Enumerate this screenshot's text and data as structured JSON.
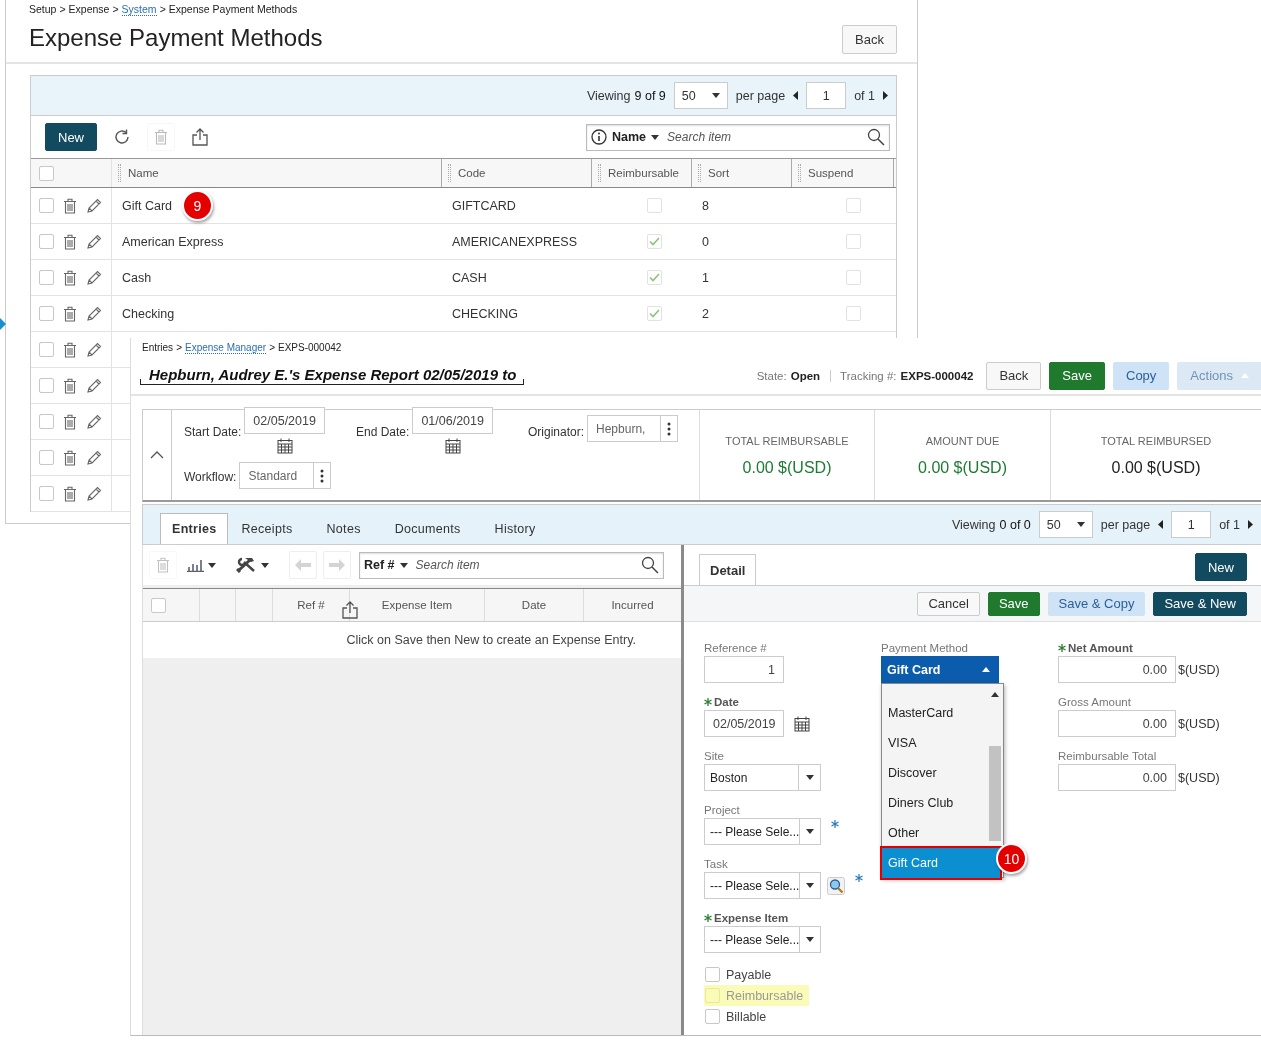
{
  "back_window": {
    "breadcrumb": {
      "separator": ">",
      "items": [
        {
          "text": "Setup",
          "link": false
        },
        {
          "text": "Expense",
          "link": false
        },
        {
          "text": "System",
          "link": true
        },
        {
          "text": "Expense Payment Methods",
          "link": false
        }
      ]
    },
    "title": "Expense Payment Methods",
    "back_button": "Back",
    "pager": {
      "viewing": "Viewing",
      "count": "9 of 9",
      "per_page": "50",
      "per_page_label": "per page",
      "page": "1",
      "of": "of 1"
    },
    "new_button": "New",
    "search": {
      "field": "Name",
      "placeholder": "Search item"
    },
    "select_all_checked": false,
    "columns": [
      "Name",
      "Code",
      "Reimbursable",
      "Sort",
      "Suspend"
    ],
    "rows": [
      {
        "kind": "full",
        "checked": false,
        "name": "Gift Card",
        "callout": "9",
        "code": "GIFTCARD",
        "reimbursable": false,
        "sort": "8",
        "suspend": false
      },
      {
        "kind": "full",
        "checked": false,
        "name": "American Express",
        "code": "AMERICANEXPRESS",
        "reimbursable": true,
        "sort": "0",
        "suspend": false
      },
      {
        "kind": "full",
        "checked": false,
        "name": "Cash",
        "code": "CASH",
        "reimbursable": true,
        "sort": "1",
        "suspend": false
      },
      {
        "kind": "full",
        "checked": false,
        "name": "Checking",
        "code": "CHECKING",
        "reimbursable": true,
        "sort": "2",
        "suspend": false
      },
      {
        "kind": "covered",
        "checked": false
      },
      {
        "kind": "covered",
        "checked": false
      },
      {
        "kind": "covered",
        "checked": false
      },
      {
        "kind": "covered",
        "checked": false
      },
      {
        "kind": "covered",
        "checked": false
      }
    ]
  },
  "front_window": {
    "breadcrumb": {
      "separator": ">",
      "items": [
        {
          "text": "Entries",
          "link": false
        },
        {
          "text": "Expense Manager",
          "link": true
        },
        {
          "text": "EXPS-000042",
          "link": false
        }
      ]
    },
    "title": "Hepburn, Audrey E.'s Expense Report 02/05/2019 to",
    "state_label": "State:",
    "state": "Open",
    "tracking_label": "Tracking #:",
    "tracking": "EXPS-000042",
    "buttons": [
      {
        "label": "Back",
        "kind": "default",
        "disabled": false
      },
      {
        "label": "Save",
        "kind": "primary",
        "disabled": false
      },
      {
        "label": "Copy",
        "kind": "light",
        "disabled": false
      },
      {
        "label": "Actions",
        "kind": "menu",
        "disabled": true
      }
    ],
    "header_fields": [
      {
        "label": "Start Date:",
        "value": "02/05/2019",
        "kind": "date"
      },
      {
        "label": "End Date:",
        "value": "01/06/2019",
        "kind": "date"
      },
      {
        "label": "Originator:",
        "value": "Hepburn,",
        "kind": "picker"
      },
      {
        "label": "Workflow:",
        "value": "Standard",
        "kind": "picker"
      }
    ],
    "totals": [
      {
        "label": "TOTAL REIMBURSABLE",
        "value": "0.00 $(USD)",
        "color": "#1e7b34"
      },
      {
        "label": "AMOUNT DUE",
        "value": "0.00 $(USD)",
        "color": "#1e7b34"
      },
      {
        "label": "TOTAL REIMBURSED",
        "value": "0.00 $(USD)",
        "color": "#222222"
      }
    ],
    "tabs": [
      {
        "label": "Entries",
        "selected": true
      },
      {
        "label": "Receipts",
        "selected": false
      },
      {
        "label": "Notes",
        "selected": false
      },
      {
        "label": "Documents",
        "selected": false
      },
      {
        "label": "History",
        "selected": false
      }
    ],
    "pager": {
      "viewing": "Viewing",
      "count": "0 of 0",
      "per_page": "50",
      "per_page_label": "per page",
      "page": "1",
      "of": "of 1"
    },
    "search": {
      "field": "Ref #",
      "placeholder": "Search item"
    },
    "select_all_checked": false,
    "columns": [
      "Ref #",
      "Expense Item",
      "Date",
      "Incurred"
    ],
    "empty_message": "Click on Save then New to create an Expense Entry.",
    "detail": {
      "tab": "Detail",
      "new_button": "New",
      "actions": [
        {
          "label": "Cancel",
          "kind": "default"
        },
        {
          "label": "Save",
          "kind": "primary"
        },
        {
          "label": "Save & Copy",
          "kind": "light"
        },
        {
          "label": "Save & New",
          "kind": "dark"
        }
      ],
      "left_fields": [
        {
          "label": "Reference #",
          "kind": "number",
          "value": "1",
          "required": false
        },
        {
          "label": "Date",
          "kind": "date",
          "value": "02/05/2019",
          "required": true
        },
        {
          "label": "Site",
          "kind": "select",
          "value": "Boston",
          "required": false
        },
        {
          "label": "Project",
          "kind": "select",
          "value": "--- Please Sele...",
          "required": false,
          "flagged": true
        },
        {
          "label": "Task",
          "kind": "select",
          "value": "--- Please Sele...",
          "required": false,
          "flagged": true,
          "lookup": true
        },
        {
          "label": "Expense Item",
          "kind": "select",
          "value": "--- Please Sele...",
          "required": true
        }
      ],
      "checkboxes": [
        {
          "label": "Payable",
          "checked": false,
          "highlighted": false
        },
        {
          "label": "Reimbursable",
          "checked": false,
          "highlighted": true
        },
        {
          "label": "Billable",
          "checked": false,
          "highlighted": false
        }
      ],
      "payment_method": {
        "label": "Payment Method",
        "value": "Gift Card",
        "expanded": true,
        "options": [
          {
            "label": "MasterCard",
            "selected": false
          },
          {
            "label": "VISA",
            "selected": false
          },
          {
            "label": "Discover",
            "selected": false
          },
          {
            "label": "Diners Club",
            "selected": false
          },
          {
            "label": "Other",
            "selected": false
          },
          {
            "label": "Gift Card",
            "selected": true,
            "callout": "10"
          }
        ]
      },
      "amounts": [
        {
          "label": "Net Amount",
          "required": true,
          "value": "0.00",
          "unit": "$(USD)"
        },
        {
          "label": "Gross Amount",
          "required": false,
          "value": "0.00",
          "unit": "$(USD)"
        },
        {
          "label": "Reimbursable Total",
          "required": false,
          "value": "0.00",
          "unit": "$(USD)"
        }
      ]
    }
  }
}
